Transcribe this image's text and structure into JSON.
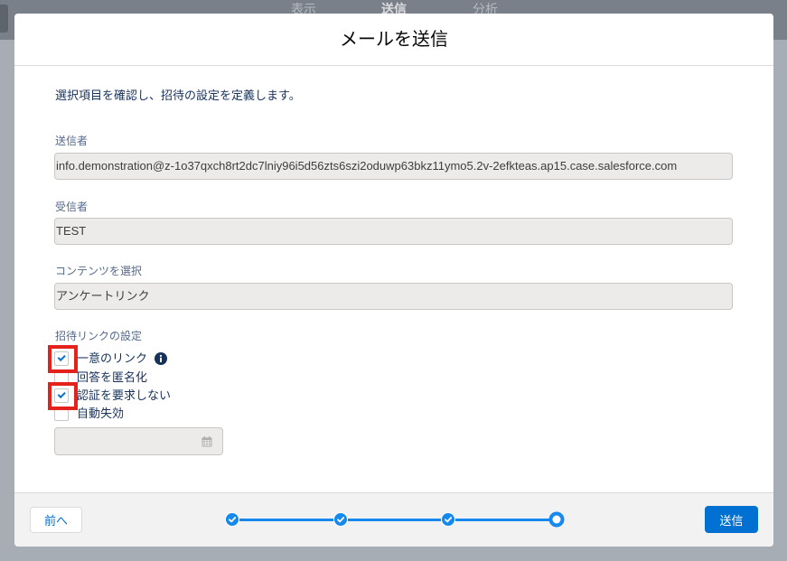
{
  "background_page": {
    "tabs": [
      "表示",
      "送信",
      "分析"
    ]
  },
  "modal": {
    "title": "メールを送信",
    "intro": "選択項目を確認し、招待の設定を定義します。",
    "sender": {
      "label": "送信者",
      "value": "info.demonstration@z-1o37qxch8rt2dc7lniy96i5d56zts6szi2oduwp63bkz11ymo5.2v-2efkteas.ap15.case.salesforce.com"
    },
    "recipient": {
      "label": "受信者",
      "value": "TEST"
    },
    "content": {
      "label": "コンテンツを選択",
      "value": "アンケートリンク"
    },
    "invite_settings": {
      "label": "招待リンクの設定",
      "options": [
        {
          "label": "一意のリンク",
          "checked": true,
          "highlighted": true,
          "icon": "info-icon"
        },
        {
          "label": "回答を匿名化",
          "checked": false,
          "highlighted": false
        },
        {
          "label": "認証を要求しない",
          "checked": true,
          "highlighted": true
        },
        {
          "label": "自動失効",
          "checked": false,
          "highlighted": false
        }
      ],
      "expiry_date": {
        "icon": "calendar-icon"
      }
    }
  },
  "footer": {
    "back_label": "前へ",
    "send_label": "送信",
    "progress_steps": [
      {
        "done": true
      },
      {
        "done": true
      },
      {
        "done": true
      },
      {
        "done": false,
        "current": true
      }
    ]
  },
  "colors": {
    "accent": "#0070d2",
    "progress": "#1589ee",
    "highlight": "#e4211b",
    "text": "#16325c"
  }
}
